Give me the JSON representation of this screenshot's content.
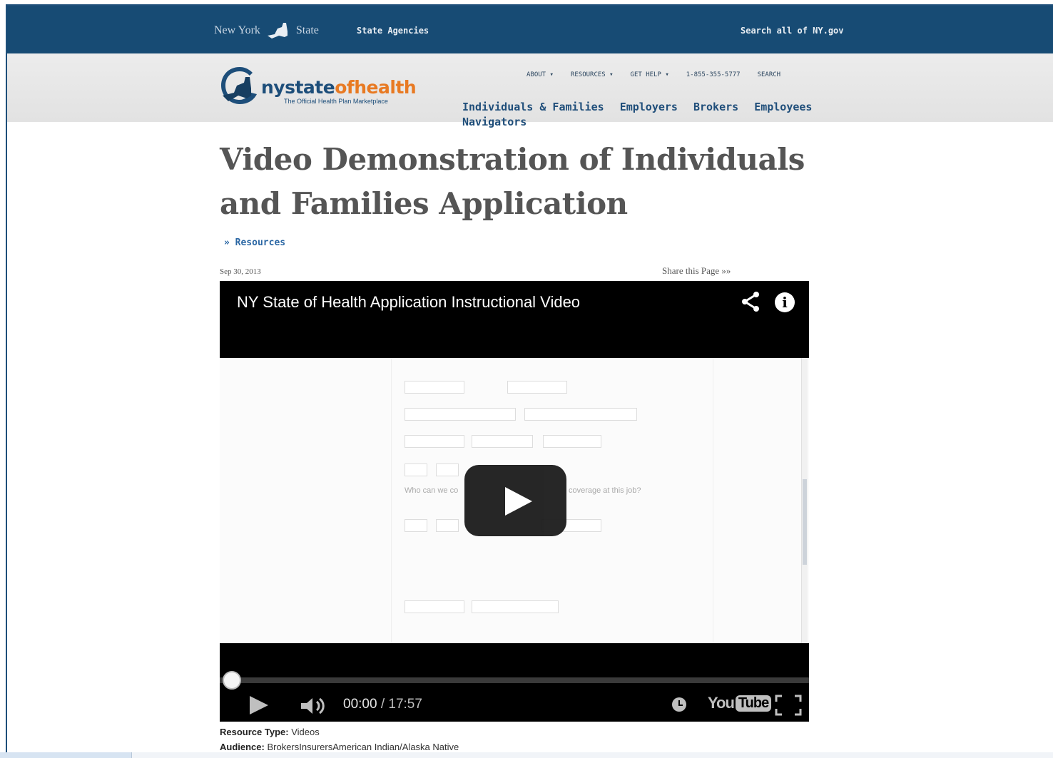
{
  "topbar": {
    "ny_left": "New York",
    "ny_right": "State",
    "state_agencies": "State Agencies",
    "search_all": "Search all of NY.gov"
  },
  "brand": {
    "name_a": "nystate",
    "name_b": "ofhealth",
    "tagline": "The Official Health Plan Marketplace"
  },
  "utility_nav": [
    "ABOUT ▾",
    "RESOURCES ▾",
    "GET HELP ▾",
    "1-855-355-5777",
    "SEARCH"
  ],
  "main_nav": [
    "Individuals & Families",
    "Employers",
    "Brokers",
    "Employees",
    "Navigators"
  ],
  "page": {
    "title": "Video Demonstration of Individuals and Families Application",
    "breadcrumb": "» Resources",
    "date": "Sep 30, 2013",
    "share": "Share this Page »»"
  },
  "video": {
    "title": "NY State of Health Application Instructional Video",
    "current_time": "00:00",
    "separator": "/",
    "duration": "17:57",
    "progress": 0,
    "youtube_you": "You",
    "youtube_tube": "Tube",
    "form_question_1": "Who can we co",
    "form_question_2": "coverage at this job?"
  },
  "meta": {
    "resource_type_label": "Resource Type:",
    "resource_type_value": "Videos",
    "audience_label": "Audience:",
    "audience_value": "BrokersInsurersAmerican Indian/Alaska Native"
  },
  "colors": {
    "topbar": "#174b74",
    "brand_blue": "#1d4e7a",
    "brand_orange": "#e87a23",
    "link": "#2b67a4"
  }
}
